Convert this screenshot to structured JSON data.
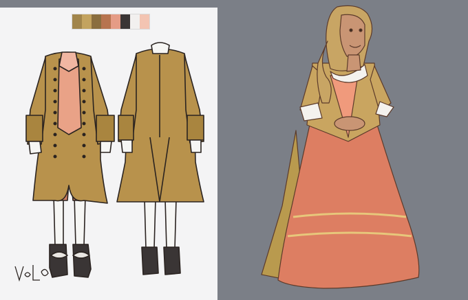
{
  "palette": [
    "#a1854b",
    "#c3a35f",
    "#8a6e3f",
    "#b7744f",
    "#e59c86",
    "#3a3535",
    "#f2f0ef",
    "#f3c4b2"
  ],
  "signature": "VaL",
  "colors": {
    "background": "#7b7f87",
    "sheet": "#f4f4f5",
    "coat": "#b8924c",
    "skirt": "#dd7e62"
  }
}
